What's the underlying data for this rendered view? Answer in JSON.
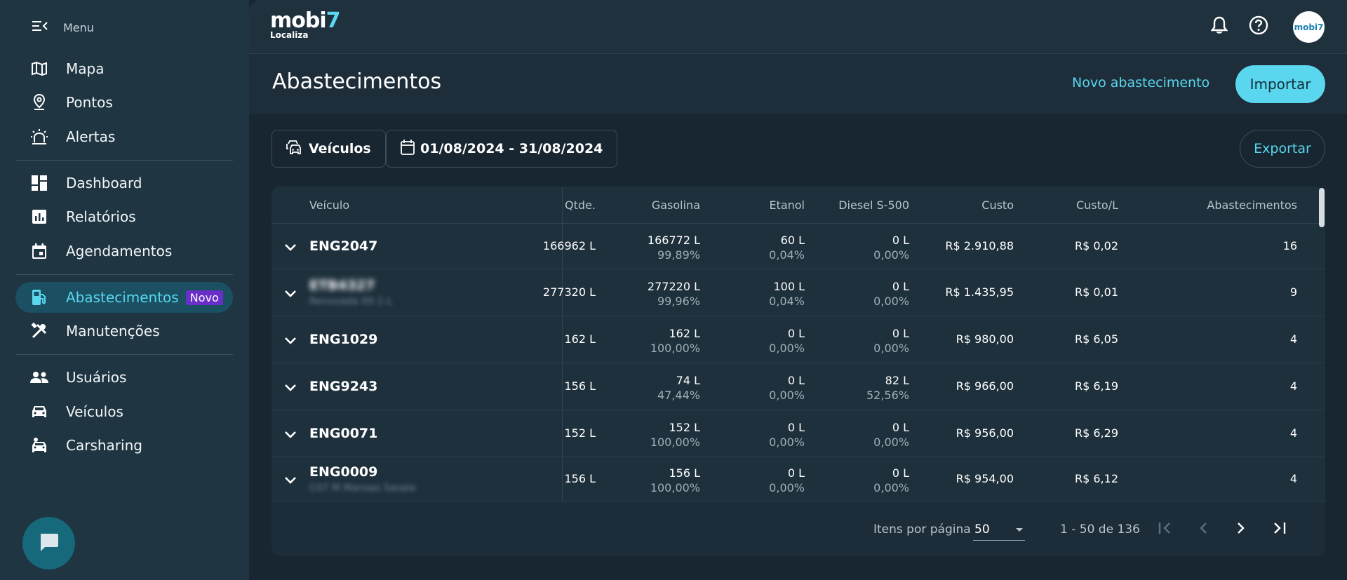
{
  "sidebar": {
    "menu_label": "Menu",
    "items": [
      {
        "label": "Mapa",
        "icon": "map-icon"
      },
      {
        "label": "Pontos",
        "icon": "location-pin-icon"
      },
      {
        "label": "Alertas",
        "icon": "siren-icon"
      },
      {
        "label": "Dashboard",
        "icon": "dashboard-icon"
      },
      {
        "label": "Relatórios",
        "icon": "bar-chart-icon"
      },
      {
        "label": "Agendamentos",
        "icon": "calendar-icon"
      },
      {
        "label": "Abastecimentos",
        "icon": "fuel-pump-icon",
        "badge": "Novo",
        "active": true
      },
      {
        "label": "Manutenções",
        "icon": "tools-icon"
      },
      {
        "label": "Usuários",
        "icon": "users-icon"
      },
      {
        "label": "Veículos",
        "icon": "car-icon"
      },
      {
        "label": "Carsharing",
        "icon": "carsharing-icon"
      }
    ]
  },
  "topbar": {
    "logo_word": "mobi",
    "logo_seven": "7",
    "logo_sub": "Localiza",
    "avatar_text": "mobi7"
  },
  "header": {
    "title": "Abastecimentos",
    "new_link": "Novo abastecimento",
    "import_label": "Importar"
  },
  "filters": {
    "vehicles_label": "Veículos",
    "date_range": "01/08/2024 - 31/08/2024",
    "export_label": "Exportar"
  },
  "table": {
    "headers": {
      "vehicle": "Veículo",
      "qty": "Qtde.",
      "gasoline": "Gasolina",
      "ethanol": "Etanol",
      "diesel": "Diesel S-500",
      "cost": "Custo",
      "cost_per_l": "Custo/L",
      "refuels": "Abastecimentos"
    },
    "rows": [
      {
        "vehicle": "ENG2047",
        "vehicle_sub": "",
        "qty": "166962 L",
        "gas": "166772 L",
        "gas_pct": "99,89%",
        "eth": "60 L",
        "eth_pct": "0,04%",
        "die": "0 L",
        "die_pct": "0,00%",
        "cost": "R$ 2.910,88",
        "cpl": "R$ 0,02",
        "count": "16"
      },
      {
        "vehicle": "ETB4327",
        "vehicle_sub": "Renovada 00-1-L",
        "qty": "277320 L",
        "gas": "277220 L",
        "gas_pct": "99,96%",
        "eth": "100 L",
        "eth_pct": "0,04%",
        "die": "0 L",
        "die_pct": "0,00%",
        "cost": "R$ 1.435,95",
        "cpl": "R$ 0,01",
        "count": "9"
      },
      {
        "vehicle": "ENG1029",
        "vehicle_sub": "",
        "qty": "162 L",
        "gas": "162 L",
        "gas_pct": "100,00%",
        "eth": "0 L",
        "eth_pct": "0,00%",
        "die": "0 L",
        "die_pct": "0,00%",
        "cost": "R$ 980,00",
        "cpl": "R$ 6,05",
        "count": "4"
      },
      {
        "vehicle": "ENG9243",
        "vehicle_sub": "",
        "qty": "156 L",
        "gas": "74 L",
        "gas_pct": "47,44%",
        "eth": "0 L",
        "eth_pct": "0,00%",
        "die": "82 L",
        "die_pct": "52,56%",
        "cost": "R$ 966,00",
        "cpl": "R$ 6,19",
        "count": "4"
      },
      {
        "vehicle": "ENG0071",
        "vehicle_sub": "",
        "qty": "152 L",
        "gas": "152 L",
        "gas_pct": "100,00%",
        "eth": "0 L",
        "eth_pct": "0,00%",
        "die": "0 L",
        "die_pct": "0,00%",
        "cost": "R$ 956,00",
        "cpl": "R$ 6,29",
        "count": "4"
      },
      {
        "vehicle": "ENG0009",
        "vehicle_sub": "C07 M Mansas Sasala",
        "qty": "156 L",
        "gas": "156 L",
        "gas_pct": "100,00%",
        "eth": "0 L",
        "eth_pct": "0,00%",
        "die": "0 L",
        "die_pct": "0,00%",
        "cost": "R$ 954,00",
        "cpl": "R$ 6,12",
        "count": "4"
      }
    ]
  },
  "pagination": {
    "per_page_label": "Itens por página",
    "per_page_value": "50",
    "range_label": "1 - 50 de 136"
  },
  "colors": {
    "accent": "#5ad6ee",
    "sidebar_bg": "#1f3542",
    "main_bg": "#172631",
    "badge": "#6a2ec9"
  }
}
